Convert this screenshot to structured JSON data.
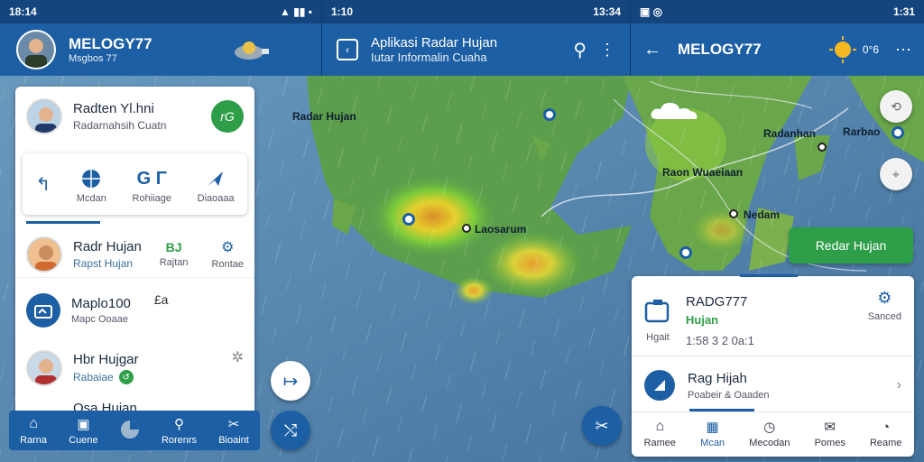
{
  "status": {
    "left": {
      "time": "18:14"
    },
    "middle_a": {
      "time": "1:10"
    },
    "middle_b": {
      "time": "13:34"
    },
    "right": {
      "time": "1:31"
    }
  },
  "left_panel": {
    "app_title": "MELOGY77",
    "app_subtitle": "Msgbos 77",
    "profile": {
      "name": "Radten Yl.hni",
      "subtitle": "Radarnahsih Cuatn",
      "badge": "rG"
    },
    "shortcuts": [
      {
        "icon": "share-icon",
        "label": ""
      },
      {
        "icon": "globe-icon",
        "label": "Mcdan"
      },
      {
        "icon": "g-icon",
        "label": "Rohiiage"
      },
      {
        "icon": "nav-arrow-icon",
        "label": "Diaoaaa"
      }
    ],
    "list": [
      {
        "title": "Radr Hujan",
        "subtitle": "Rapst Hujan",
        "badge": "BJ",
        "badge_sub": "Rajtan",
        "action_label": "Rontae"
      },
      {
        "title": "Maplo100",
        "subtitle": "Mapc Ooaae",
        "badge": "£a"
      },
      {
        "title": "Hbr Hujgar",
        "subtitle": "Rabaiae"
      },
      {
        "title": "Osa Hujan"
      }
    ],
    "bottom_nav": [
      {
        "icon": "home-icon",
        "label": "Rarna"
      },
      {
        "icon": "chat-icon",
        "label": "Cuene"
      },
      {
        "icon": "pie-icon",
        "label": ""
      },
      {
        "icon": "search-icon",
        "label": "Rorenrs"
      },
      {
        "icon": "tools-icon",
        "label": "Bioaint"
      }
    ]
  },
  "middle_bar": {
    "title": "Aplikasi Radar Hujan",
    "subtitle": "Iutar Informalin Cuaha"
  },
  "right_bar": {
    "title": "MELOGY77",
    "weather": "0°6"
  },
  "map_labels": {
    "a": "Radar Hujan",
    "b": "Laosarum",
    "c": "Radanhan",
    "d": "Rarbao",
    "e": "Raon Wuaeiaan",
    "f": "Nedam"
  },
  "green_button": {
    "label": "Redar Hujan"
  },
  "right_panel": {
    "top": {
      "title": "RADG777",
      "subtitle": "Hujan",
      "label_left": "Hgait",
      "time": "1:58 3 2 0a:1",
      "action": "Sanced"
    },
    "row2": {
      "title": "Rag Hijah",
      "subtitle": "Poabeir & Oaaden"
    },
    "bottom_nav": [
      {
        "icon": "home-icon",
        "label": "Ramee"
      },
      {
        "icon": "map-icon",
        "label": "Mcan"
      },
      {
        "icon": "clock-icon",
        "label": "Mecodan"
      },
      {
        "icon": "chat-icon",
        "label": "Pomes"
      },
      {
        "icon": "compass-icon",
        "label": "Reame"
      }
    ]
  },
  "colors": {
    "primary": "#1d5fa4",
    "dark": "#14457e",
    "accent_green": "#2e9e49"
  }
}
